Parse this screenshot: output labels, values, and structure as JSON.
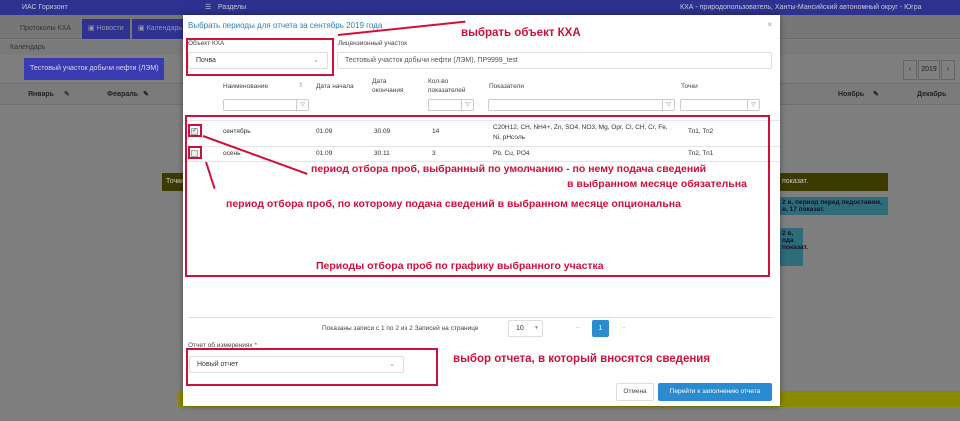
{
  "app": {
    "title": "ИАС Горизонт",
    "menu_label": "Разделы",
    "user": "КХА - природопользователь, Ханты-Мансийский автономный округ - Югра"
  },
  "tabs": [
    {
      "label": "Протоколы КХА"
    },
    {
      "label": "Новости"
    },
    {
      "label": "Календарь"
    }
  ],
  "breadcrumb": "Календарь",
  "object_button": "Тестовый участок добычи нефти (ЛЭМ)",
  "year": "2019",
  "months": [
    "Январь",
    "Февраль",
    "Ноябрь",
    "Декабрь"
  ],
  "events": {
    "left": "Точки",
    "right": "показат.",
    "teal1": "2 в, период перед ледоставом, в, 17 показат.",
    "teal2": "2 в, ода показат."
  },
  "modal": {
    "title": "Выбрать периоды для отчета за сентябрь 2019 года",
    "close": "×",
    "object_label": "Объект КХА",
    "object_value": "Почва",
    "license_label": "Лицензионный участок",
    "license_value": "Тестовый участок добычи нефти (ЛЭМ), ПР9999_test",
    "columns": [
      "Наименование",
      "Дата начала",
      "Дата окончания",
      "Кол-во показателей",
      "Показатели",
      "Точки"
    ],
    "rows": [
      {
        "checked": true,
        "name": "сентябрь",
        "start": "01.09",
        "end": "30.09",
        "count": "14",
        "indicators": "C20H12, CH, NH4+, Zn, SO4, NO3, Mg, Opr, Cl, CH, Cr, Fe, Ni, pHсоль",
        "points": "Тп1, Тп2"
      },
      {
        "checked": false,
        "name": "осень",
        "start": "01.09",
        "end": "30.11",
        "count": "3",
        "indicators": "Pb, Cu, PO4",
        "points": "Тп2, Тп1"
      }
    ],
    "pagination": {
      "info": "Показаны записи с 1 по 2 из 2",
      "per_page_label": "Записей на странице",
      "per_page": "10",
      "prev": "←",
      "page": "1",
      "next": "→"
    },
    "report_label": "Отчет об измерениях",
    "required": "*",
    "report_value": "Новый отчет",
    "cancel": "Отмена",
    "submit": "Перейти к заполнению отчета"
  },
  "annotations": {
    "object": "выбрать объект КХА",
    "default_period_1": "период отбора проб, выбранный по умолчанию - по нему подача сведений",
    "default_period_2": "в выбранном месяце обязательна",
    "optional_period": "период отбора проб, по которому подача сведений в выбранном месяце опциональна",
    "periods": "Периоды отбора проб по графику выбранного участка",
    "report": "выбор отчета, в который вносятся сведения"
  },
  "colors": {
    "accent": "#2a7fc0",
    "annotation": "#d0103a",
    "topbar": "#2e318f"
  }
}
